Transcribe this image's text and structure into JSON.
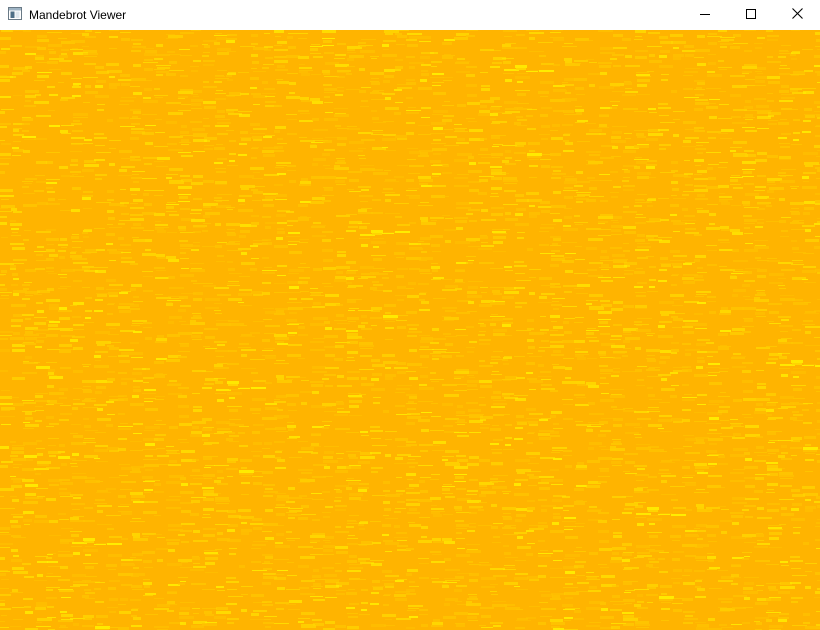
{
  "window": {
    "title": "Mandebrot Viewer",
    "icon": "app-window-icon",
    "controls": {
      "minimize_icon": "minimize-icon",
      "maximize_icon": "maximize-icon",
      "close_icon": "close-icon"
    }
  },
  "canvas": {
    "description_colors": {
      "base": "#ffb400",
      "light": "#ffc400",
      "bright": "#ffd800",
      "highlight": "#fff000"
    },
    "pattern": "dense horizontal yellow streaks on orange-yellow background"
  }
}
